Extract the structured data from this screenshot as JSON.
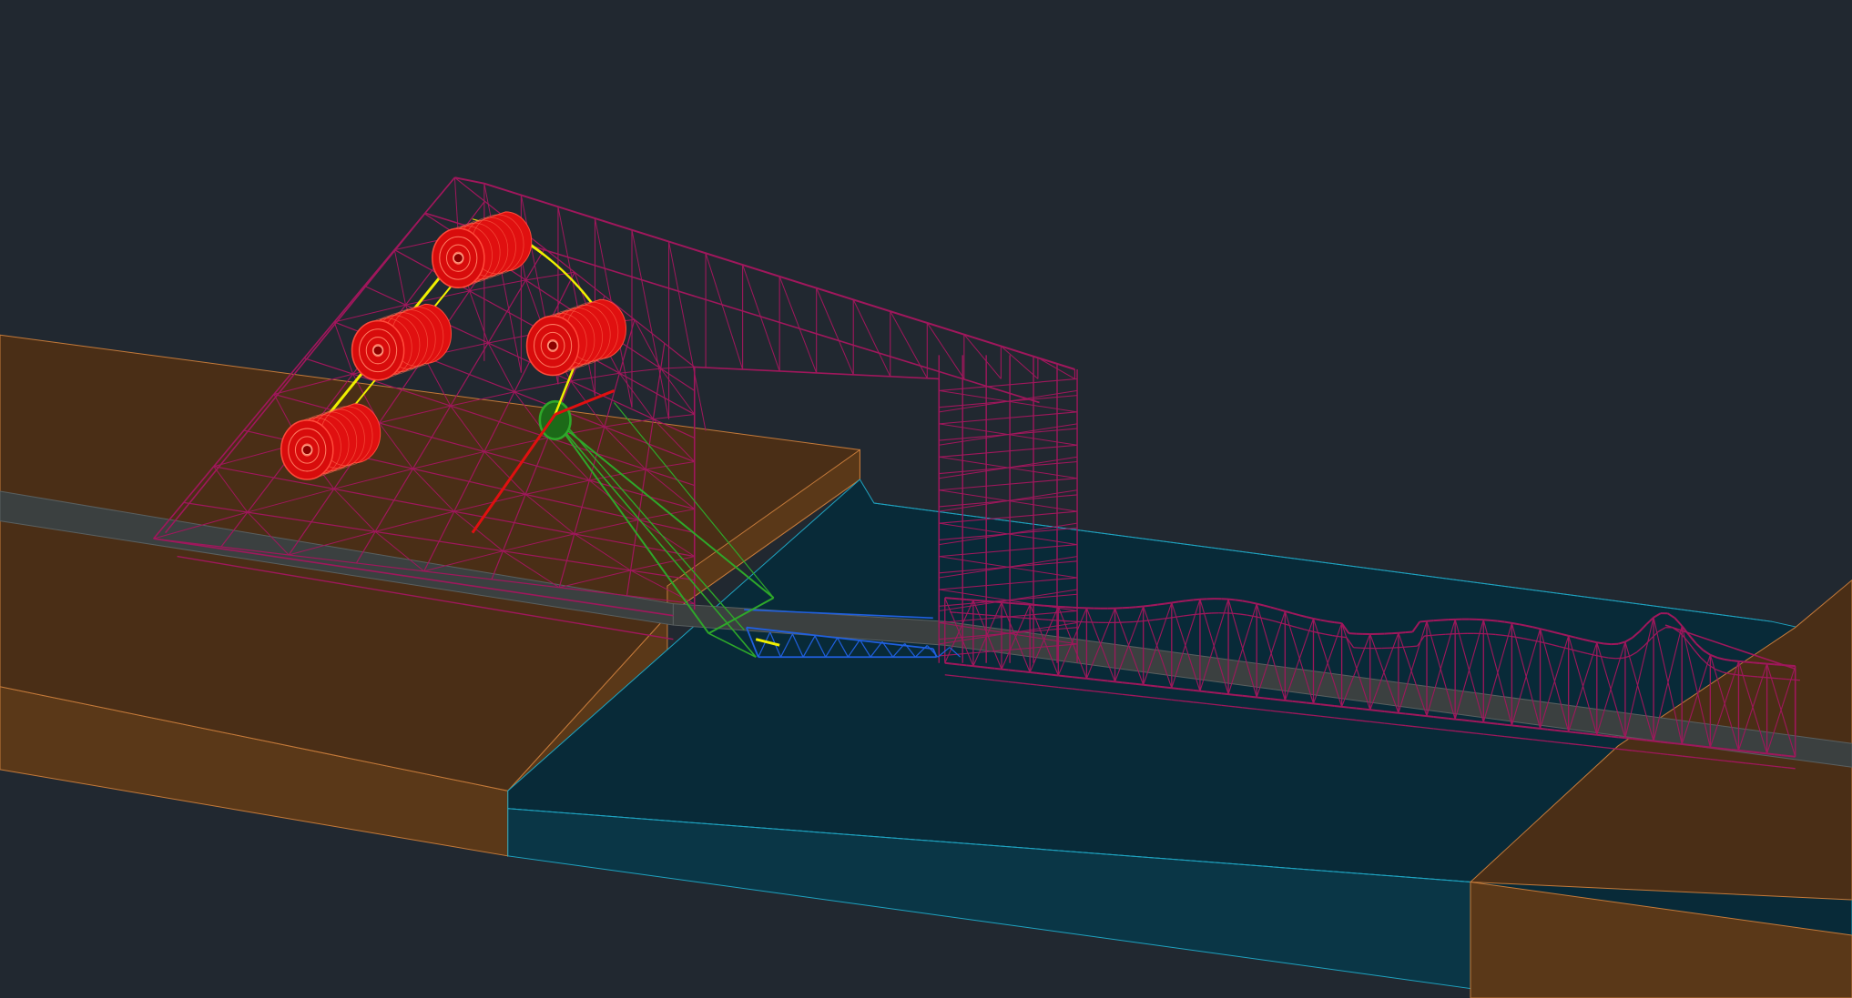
{
  "viewport": {
    "background": "#212830",
    "visual_style": "wireframe-3d"
  },
  "colors": {
    "ground_top": "#4a2e16",
    "ground_side": "#5a3818",
    "ground_edge": "#c47a3a",
    "water_top": "#082a38",
    "water_side": "#0a3646",
    "water_edge": "#1fa3c0",
    "deck": "#3b4040",
    "truss": "#a0175c",
    "counterweight": "#e01010",
    "counterweight_edge": "#ff4a3a",
    "cable": "#f0f000",
    "strut": "#2ea82a",
    "bascule_leaf": "#2060e0"
  },
  "layers": [
    {
      "name": "ground",
      "icon": "terrain-icon"
    },
    {
      "name": "water",
      "icon": "water-icon"
    },
    {
      "name": "deck",
      "icon": "road-icon"
    },
    {
      "name": "truss",
      "icon": "truss-icon"
    },
    {
      "name": "counterweights",
      "icon": "cylinder-icon"
    },
    {
      "name": "cables",
      "icon": "cable-icon"
    },
    {
      "name": "struts",
      "icon": "strut-icon"
    },
    {
      "name": "bascule",
      "icon": "bridge-leaf-icon"
    }
  ]
}
